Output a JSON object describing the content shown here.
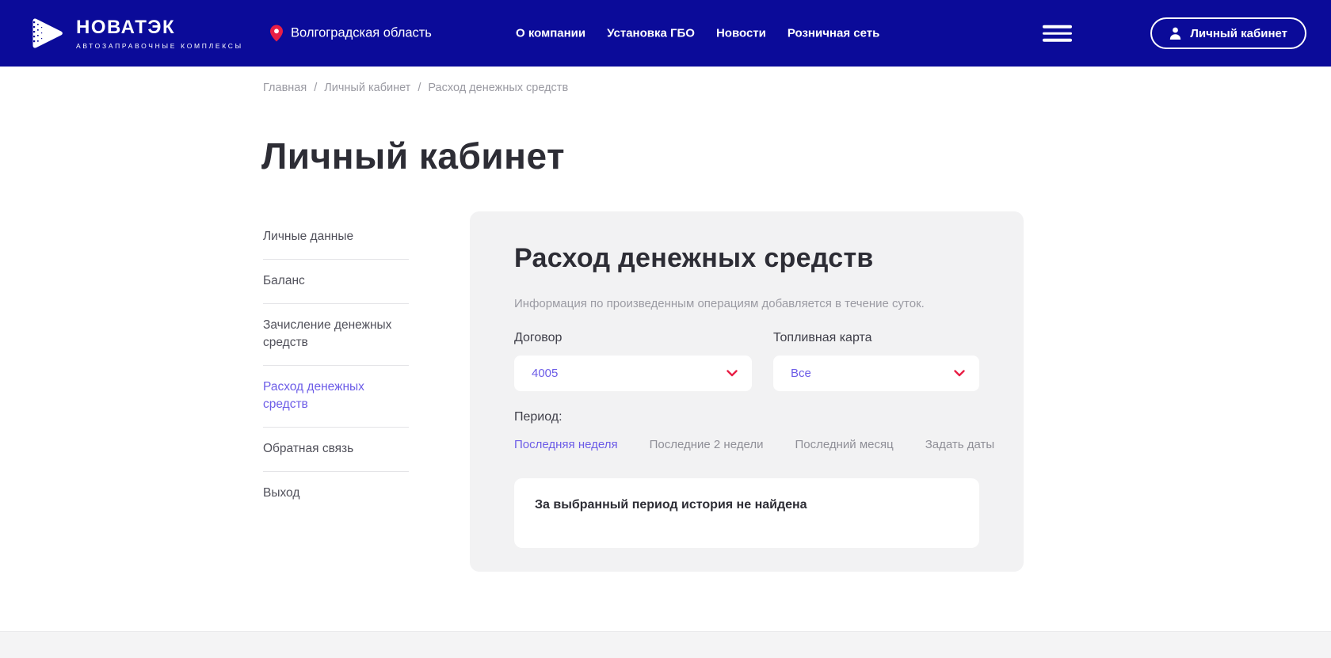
{
  "colors": {
    "header_blue": "#0B0B99",
    "accent_red": "#E81E45",
    "accent_purple": "#6C5CE7",
    "panel_gray": "#F2F2F3"
  },
  "header": {
    "logo": {
      "title": "НОВАТЭК",
      "subtitle": "АВТОЗАПРАВОЧНЫЕ КОМПЛЕКСЫ"
    },
    "region": "Волгоградская область",
    "nav": [
      "О компании",
      "Установка ГБО",
      "Новости",
      "Розничная сеть"
    ],
    "account_button": "Личный кабинет"
  },
  "breadcrumb": {
    "separator": "/",
    "items": [
      "Главная",
      "Личный кабинет",
      "Расход денежных средств"
    ]
  },
  "page_title": "Личный кабинет",
  "sidebar": {
    "items": [
      {
        "label": "Личные данные",
        "active": false
      },
      {
        "label": "Баланс",
        "active": false
      },
      {
        "label": "Зачисление денежных средств",
        "active": false
      },
      {
        "label": "Расход денежных средств",
        "active": true
      },
      {
        "label": "Обратная связь",
        "active": false
      },
      {
        "label": "Выход",
        "active": false
      }
    ]
  },
  "panel": {
    "title": "Расход денежных средств",
    "note": "Информация по произведенным операциям добавляется в течение суток.",
    "contract": {
      "label": "Договор",
      "value": "4005"
    },
    "fuel_card": {
      "label": "Топливная карта",
      "value": "Все"
    },
    "period": {
      "label": "Период:",
      "options": [
        {
          "label": "Последняя неделя",
          "active": true
        },
        {
          "label": "Последние 2 недели",
          "active": false
        },
        {
          "label": "Последний месяц",
          "active": false
        },
        {
          "label": "Задать даты",
          "active": false
        }
      ]
    },
    "empty_message": "За выбранный период история не найдена"
  }
}
